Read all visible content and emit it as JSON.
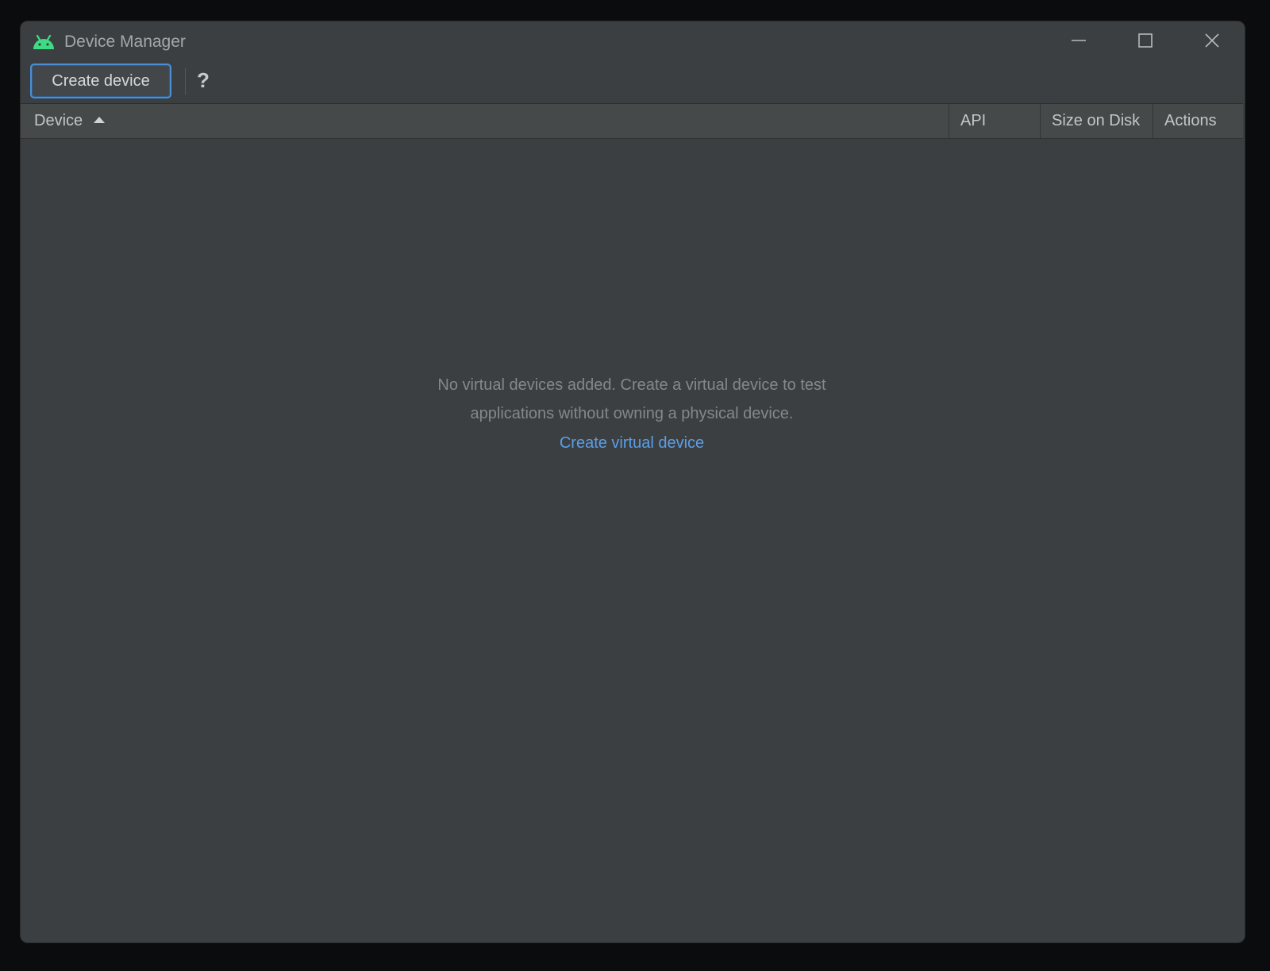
{
  "window": {
    "title": "Device Manager",
    "app_icon": "android-icon",
    "controls": {
      "minimize_icon": "minimize-icon",
      "maximize_icon": "maximize-icon",
      "close_icon": "close-icon"
    }
  },
  "toolbar": {
    "create_label": "Create device",
    "help_label": "?"
  },
  "table": {
    "columns": [
      {
        "label": "Device",
        "sorted": "ascending"
      },
      {
        "label": "API"
      },
      {
        "label": "Size on Disk"
      },
      {
        "label": "Actions"
      }
    ],
    "rows": []
  },
  "empty_state": {
    "line1": "No virtual devices added. Create a virtual device to test",
    "line2": "applications without owning a physical device.",
    "link_label": "Create virtual device"
  },
  "colors": {
    "window_bg": "#3c3f41",
    "header_bg": "#45494a",
    "accent": "#4a8fd6",
    "link": "#5a9fe6",
    "android_green": "#3ddc84"
  }
}
